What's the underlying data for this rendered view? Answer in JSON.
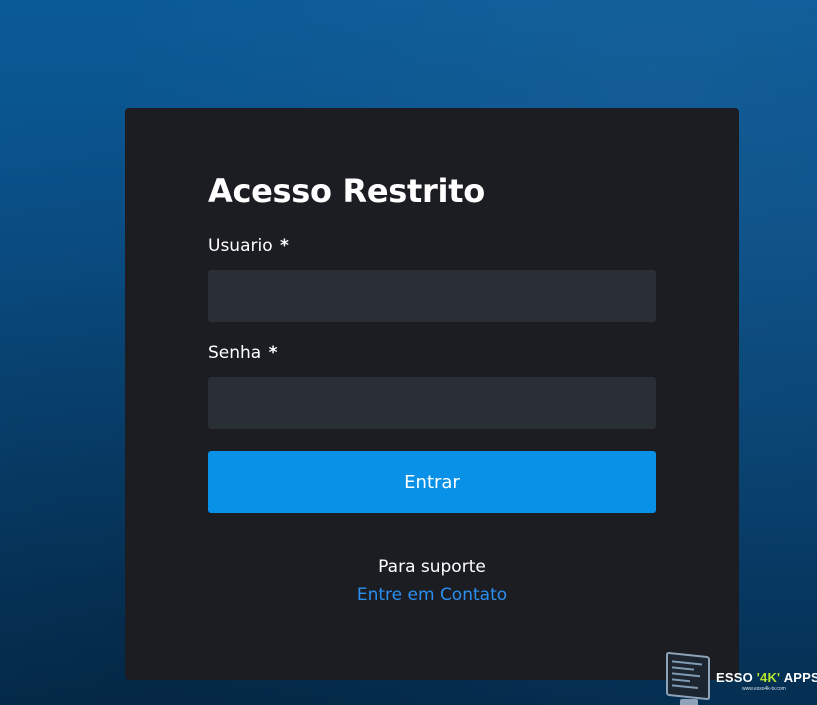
{
  "login": {
    "title": "Acesso Restrito",
    "username_label": "Usuario",
    "password_label": "Senha",
    "required_marker": "*",
    "username_value": "",
    "password_value": "",
    "submit_label": "Entrar",
    "support_text": "Para suporte",
    "contact_link": "Entre em Contato"
  },
  "watermark": {
    "brand_prefix": "ESSO",
    "brand_accent": "'4K'",
    "brand_suffix": "APPS",
    "url": "www.esso4k-tv.com"
  },
  "colors": {
    "background": "#0a4f86",
    "card": "#1b1d23",
    "input": "#2a2e35",
    "button": "#0891e6",
    "link": "#2a8ff0",
    "watermark_accent": "#b5e52c"
  }
}
